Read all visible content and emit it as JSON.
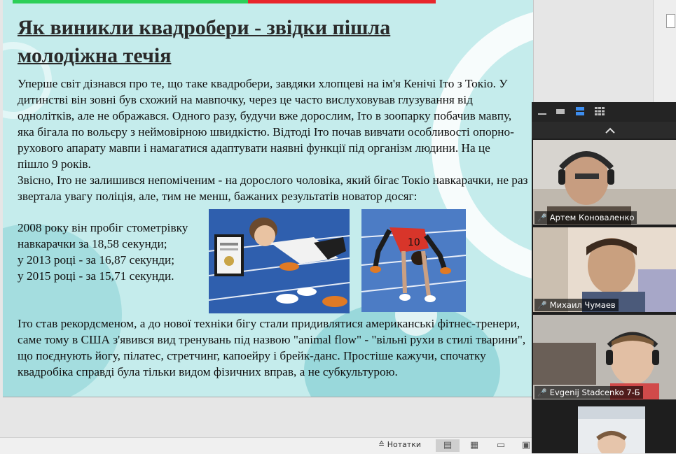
{
  "slide": {
    "title": "Як виникли квадробери - звідки пішла молодіжна течія",
    "paragraph1": "Уперше світ дізнався про те, що таке квадробери, завдяки хлопцеві на ім'я Кенічі Іто з Токіо. У дитинстві він зовні був схожий на мавпочку, через це часто вислуховував глузування від однолітків, але не ображався. Одного разу, будучи вже дорослим, Іто в зоопарку побачив мавпу, яка бігала по вольєру з неймовірною швидкістю. Відтоді Іто почав вивчати особливості опорно-рухового апарату мавпи і намагатися адаптувати наявні функції під організм людини. На це пішло 9 років.",
    "paragraph2": "Звісно, Іто не залишився непоміченим - на дорослого чоловіка, який бігає Токіо навкарачки, не раз звертала увагу поліція, але, тим не менш, бажаних результатів новатор досяг:",
    "records": [
      "2008 року він пробіг стометрівку навкарачки за 18,58 секунди;",
      "у 2013 році - за 16,87 секунди;",
      "у 2015 році - за 15,71 секунди."
    ],
    "paragraph3": "Іто став рекордсменом, а до нової техніки бігу стали придивлятися американські фітнес-тренери, саме тому в США з'явився вид тренувань під назвою \"animal flow\" - \"вільні рухи в стилі тварини\", що поєднують йогу, пілатес, стретчинг, капоейру і брейк-данс. Простіше кажучи, спочатку квадробіка справді була тільки видом фізичних вправ, а не субкультурою.",
    "colors": {
      "background": "#c5ecec",
      "accent_green": "#2dcf58",
      "accent_red": "#e8262c"
    }
  },
  "zoom": {
    "participants": [
      {
        "name": "Артем Коноваленко",
        "muted": true
      },
      {
        "name": "Михаил Чумаев",
        "muted": true
      },
      {
        "name": "Evgenij Stadcenko 7-Б",
        "muted": true
      }
    ]
  },
  "statusbar": {
    "notes_label": "Нотатки"
  }
}
